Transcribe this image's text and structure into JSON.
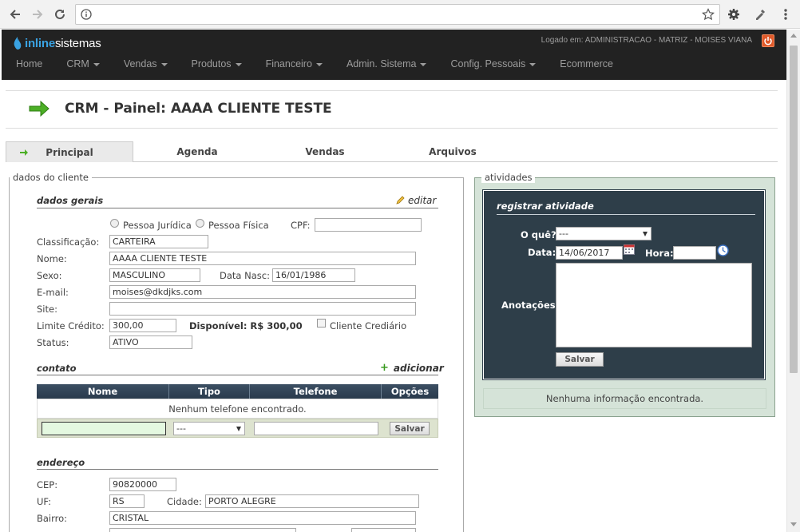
{
  "browser": {
    "url": ""
  },
  "nav": {
    "brand_a": "inline",
    "brand_b": "sistemas",
    "logged_in": "Logado em: ADMINISTRACAO - MATRIZ - MOISES VIANA",
    "menu": [
      {
        "label": "Home",
        "dropdown": false
      },
      {
        "label": "CRM",
        "dropdown": true
      },
      {
        "label": "Vendas",
        "dropdown": true
      },
      {
        "label": "Produtos",
        "dropdown": true
      },
      {
        "label": "Financeiro",
        "dropdown": true
      },
      {
        "label": "Admin. Sistema",
        "dropdown": true
      },
      {
        "label": "Config. Pessoais",
        "dropdown": true
      },
      {
        "label": "Ecommerce",
        "dropdown": false
      }
    ]
  },
  "page": {
    "title": "CRM - Painel: AAAA CLIENTE TESTE"
  },
  "tabs": [
    "Principal",
    "Agenda",
    "Vendas",
    "Arquivos"
  ],
  "client": {
    "legend": "dados do cliente",
    "general": {
      "heading": "dados gerais",
      "edit_label": "editar",
      "person_juridica": "Pessoa Jurídica",
      "person_fisica": "Pessoa Física",
      "cpf_label": "CPF:",
      "cpf": "",
      "classificacao_label": "Classificação:",
      "classificacao": "CARTEIRA",
      "nome_label": "Nome:",
      "nome": "AAAA CLIENTE TESTE",
      "sexo_label": "Sexo:",
      "sexo": "MASCULINO",
      "nasc_label": "Data Nasc:",
      "nasc": "16/01/1986",
      "email_label": "E-mail:",
      "email": "moises@dkdjks.com",
      "site_label": "Site:",
      "site": "",
      "limite_label": "Limite Crédito:",
      "limite": "300,00",
      "disponivel": "Disponível: R$ 300,00",
      "crediario": "Cliente Crediário",
      "status_label": "Status:",
      "status": "ATIVO"
    },
    "contact": {
      "heading": "contato",
      "add_label": "adicionar",
      "columns": [
        "Nome",
        "Tipo",
        "Telefone",
        "Opções"
      ],
      "empty": "Nenhum telefone encontrado.",
      "tipo_selected": "---",
      "save": "Salvar"
    },
    "address": {
      "heading": "endereço",
      "cep_label": "CEP:",
      "cep": "90820000",
      "uf_label": "UF:",
      "uf": "RS",
      "cidade_label": "Cidade:",
      "cidade": "PORTO ALEGRE",
      "bairro_label": "Bairro:",
      "bairro": "CRISTAL"
    }
  },
  "activities": {
    "legend": "atividades",
    "heading": "registrar atividade",
    "oque_label": "O quê?",
    "oque_selected": "---",
    "data_label": "Data:",
    "data": "14/06/2017",
    "hora_label": "Hora:",
    "hora": "",
    "anotacoes_label": "Anotações:",
    "save": "Salvar",
    "empty": "Nenhuma informação encontrada."
  }
}
